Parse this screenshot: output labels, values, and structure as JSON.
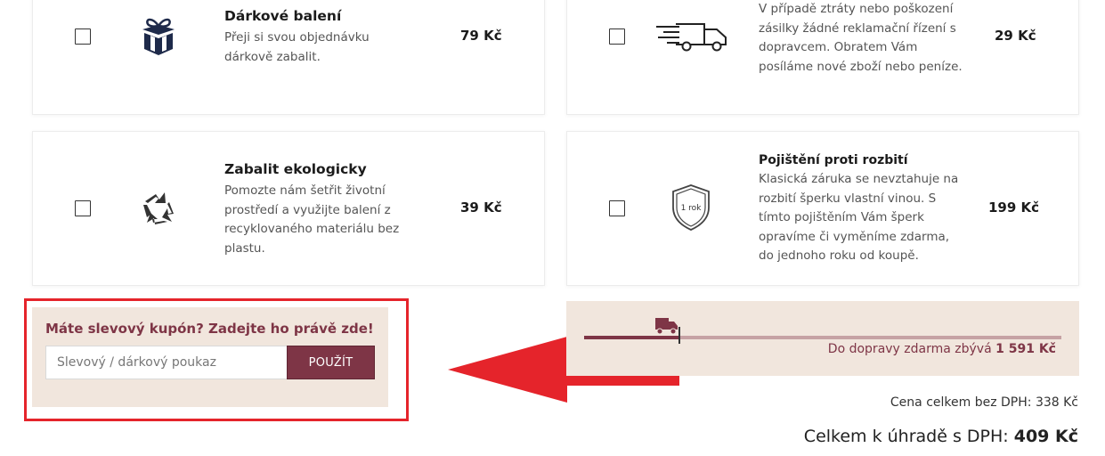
{
  "services": [
    {
      "title": "Dárkové balení",
      "description": "Přeji si svou objednávku dárkově zabalit.",
      "price": "79 Kč",
      "icon": "gift-box-icon"
    },
    {
      "title": "",
      "description": "V případě ztráty nebo poškození zásilky žádné reklamační řízení s dopravcem. Obratem Vám posíláme nové zboží nebo peníze.",
      "price": "29 Kč",
      "icon": "delivery-truck-icon"
    },
    {
      "title": "Zabalit ekologicky",
      "description": "Pomozte nám šetřit životní prostředí a využijte balení z recyklovaného materiálu bez plastu.",
      "price": "39 Kč",
      "icon": "recycle-icon"
    },
    {
      "title": "Pojištění proti rozbití",
      "description": "Klasická záruka se nevztahuje na rozbití šperku vlastní vinou. S tímto pojištěním Vám šperk opravíme či vyměníme zdarma, do jednoho roku od koupě.",
      "price": "199 Kč",
      "icon": "shield-icon",
      "icon_text": "1 rok"
    }
  ],
  "coupon": {
    "heading": "Máte slevový kupón? Zadejte ho právě zde!",
    "placeholder": "Slevový / dárkový poukaz",
    "value": "",
    "button": "POUŽÍT"
  },
  "shipping": {
    "label": "Do dopravy zdarma zbývá",
    "amount": "1 591 Kč",
    "progress": 0.2
  },
  "totals": {
    "net_label": "Cena celkem bez DPH:",
    "net_value": "338 Kč",
    "gross_label": "Celkem k úhradě s DPH:",
    "gross_value": "409 Kč"
  },
  "colors": {
    "accent": "#7e3546",
    "panel": "#f1e6dd",
    "highlight": "#e5242b"
  }
}
